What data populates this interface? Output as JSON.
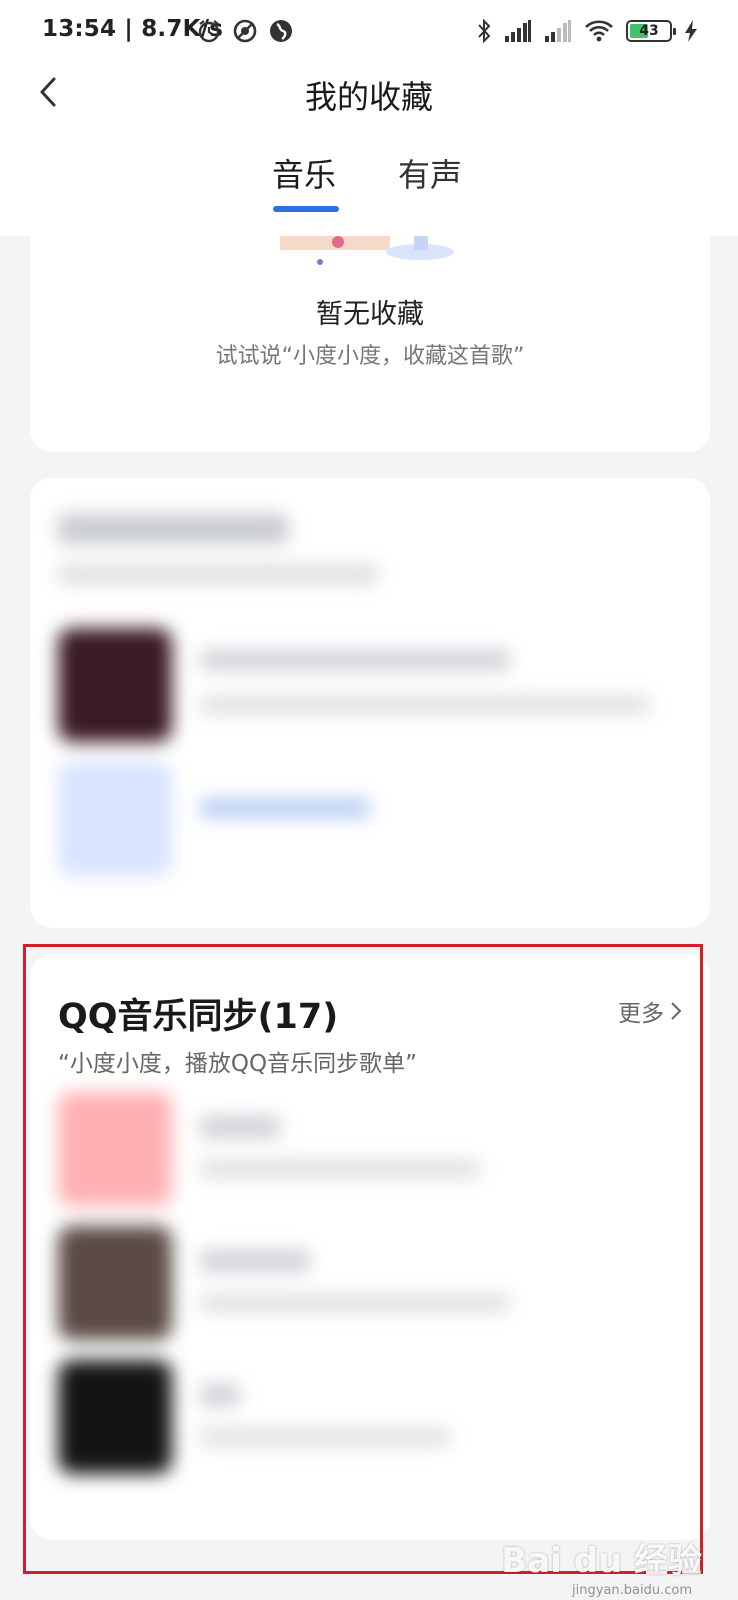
{
  "status_bar": {
    "time": "13:54 | 8.7K/s",
    "battery": "43"
  },
  "header": {
    "title": "我的收藏",
    "tabs": [
      {
        "label": "音乐",
        "active": true
      },
      {
        "label": "有声",
        "active": false
      }
    ]
  },
  "empty_state": {
    "title": "暂无收藏",
    "hint": "试试说“小度小度，收藏这首歌”"
  },
  "qq_section": {
    "title": "QQ音乐同步(17)",
    "more": "更多",
    "subtitle": "“小度小度，播放QQ音乐同步歌单”"
  },
  "watermark": {
    "brand": "Bai du 经验",
    "url": "jingyan.baidu.com"
  },
  "colors": {
    "accent": "#2f6fe6",
    "highlight_box": "#d2202b",
    "background": "#f4f4f6"
  }
}
